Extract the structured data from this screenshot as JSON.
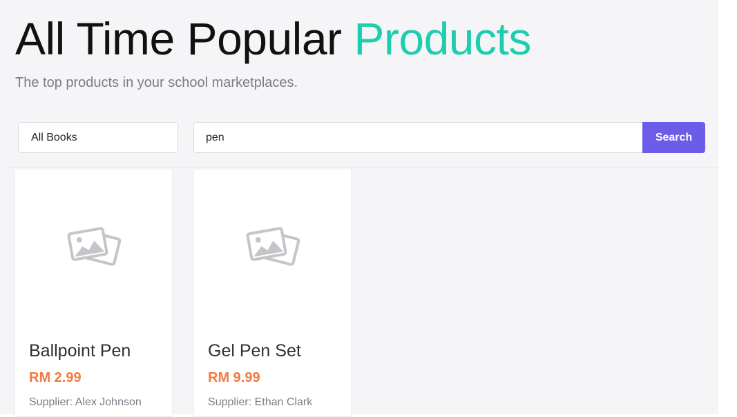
{
  "header": {
    "title_main": "All Time Popular",
    "title_accent": "Products",
    "subtitle": "The top products in your school marketplaces."
  },
  "filters": {
    "category_selected": "All Books",
    "search_value": "pen",
    "search_button_label": "Search"
  },
  "products": [
    {
      "name": "Ballpoint Pen",
      "price": "RM 2.99",
      "supplier": "Supplier: Alex Johnson",
      "image_icon": "image-placeholder-icon"
    },
    {
      "name": "Gel Pen Set",
      "price": "RM 9.99",
      "supplier": "Supplier: Ethan Clark",
      "image_icon": "image-placeholder-icon"
    }
  ],
  "colors": {
    "accent": "#1ecdb0",
    "button": "#6c5ce7",
    "price": "#f5793b"
  }
}
